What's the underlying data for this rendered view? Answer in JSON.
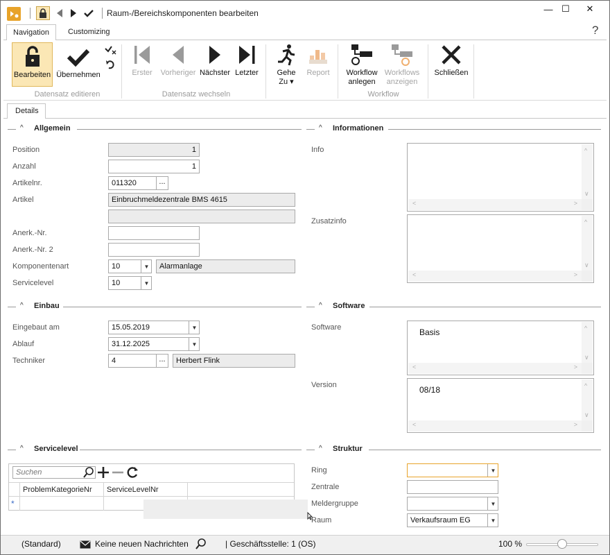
{
  "window": {
    "title": "Raum-/Bereichskomponenten bearbeiten",
    "min": "—",
    "max": "☐",
    "close": "✕"
  },
  "ribbon_tabs": [
    "Navigation",
    "Customizing"
  ],
  "help": "?",
  "ribbon": {
    "edit": "Bearbeiten",
    "apply": "Übernehmen",
    "group_edit": "Datensatz editieren",
    "first": "Erster",
    "prev": "Vorheriger",
    "next": "Nächster",
    "last": "Letzter",
    "group_nav": "Datensatz wechseln",
    "goto": "Gehe",
    "goto2": "Zu ▾",
    "report": "Report",
    "wf_create_1": "Workflow",
    "wf_create_2": "anlegen",
    "wf_show_1": "Workflows",
    "wf_show_2": "anzeigen",
    "group_wf": "Workflow",
    "close": "Schließen"
  },
  "detail_tab": "Details",
  "allgemein": {
    "title": "Allgemein",
    "position_label": "Position",
    "position": "1",
    "anzahl_label": "Anzahl",
    "anzahl": "1",
    "artikelnr_label": "Artikelnr.",
    "artikelnr": "011320",
    "artikel_label": "Artikel",
    "artikel": "Einbruchmeldezentrale BMS 4615",
    "artikel2": "",
    "anerk_label": "Anerk.-Nr.",
    "anerk": "",
    "anerk2_label": "Anerk.-Nr. 2",
    "anerk2": "",
    "komp_label": "Komponentenart",
    "komp": "10",
    "komp_text": "Alarmanlage",
    "service_label": "Servicelevel",
    "service": "10",
    "dots": "..."
  },
  "informationen": {
    "title": "Informationen",
    "info_label": "Info",
    "info": "",
    "zusatz_label": "Zusatzinfo",
    "zusatz": ""
  },
  "einbau": {
    "title": "Einbau",
    "eingebaut_label": "Eingebaut am",
    "eingebaut": "15.05.2019",
    "ablauf_label": "Ablauf",
    "ablauf": "31.12.2025",
    "techniker_label": "Techniker",
    "techniker": "4",
    "techniker_name": "Herbert Flink"
  },
  "software": {
    "title": "Software",
    "software_label": "Software",
    "software": "Basis",
    "version_label": "Version",
    "version": "08/18"
  },
  "servicelevel": {
    "title": "Servicelevel",
    "search_placeholder": "Suchen",
    "columns": [
      "ProblemKategorieNr",
      "ServiceLevelNr"
    ],
    "new_row": "*"
  },
  "struktur": {
    "title": "Struktur",
    "ring_label": "Ring",
    "ring": "",
    "zentrale_label": "Zentrale",
    "zentrale": "",
    "melder_label": "Meldergruppe",
    "melder": "",
    "raum_label": "Raum",
    "raum": "Verkaufsraum EG"
  },
  "status": {
    "standard": "(Standard)",
    "messages": "Keine neuen Nachrichten",
    "branch": "| Geschäftsstelle: 1 (OS)",
    "zoom": "100 %",
    "zoom_level": 0.5
  }
}
